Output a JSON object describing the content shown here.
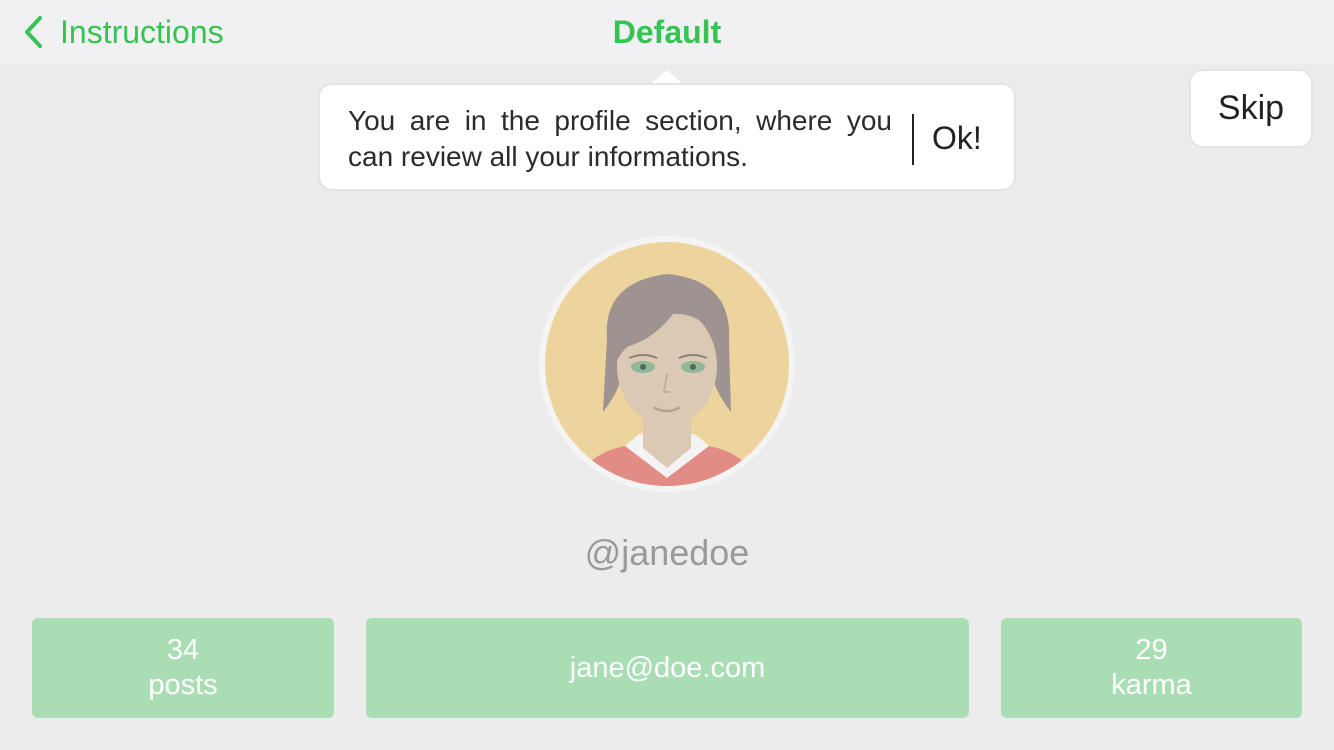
{
  "nav": {
    "back_label": "Instructions",
    "title": "Default",
    "back_icon": "chevron-left-icon"
  },
  "tooltip": {
    "text": "You are in the profile section, where you can review all your informations.",
    "ok_label": "Ok!"
  },
  "skip_label": "Skip",
  "profile": {
    "username": "@janedoe",
    "posts_count": "34",
    "posts_label": "posts",
    "email": "jane@doe.com",
    "karma_count": "29",
    "karma_label": "karma"
  },
  "colors": {
    "accent": "#35c452",
    "stat_background": "#a9ddb4",
    "page_background": "#ececec"
  }
}
